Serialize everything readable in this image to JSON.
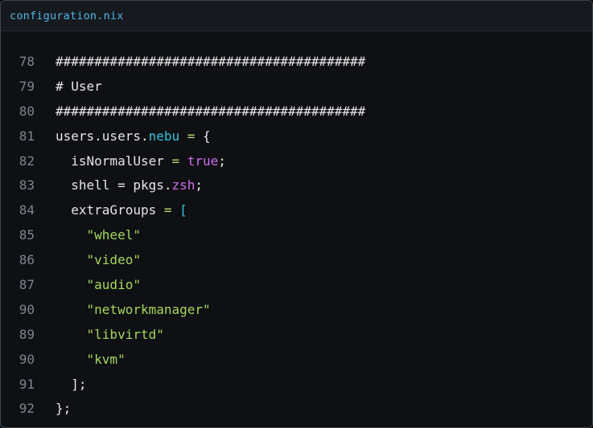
{
  "tab": {
    "filename": "configuration.nix"
  },
  "colors": {
    "background": "#0e1013",
    "tabbar": "#16191e",
    "tab_text": "#4fb7e6",
    "line_number": "#7d8590",
    "string": "#a6d65c",
    "keyword": "#d16cf0",
    "attribute": "#36c2e0"
  },
  "lines": [
    {
      "number": "78",
      "tokens": [
        {
          "text": "########################################",
          "kind": "comment"
        }
      ]
    },
    {
      "number": "79",
      "tokens": [
        {
          "text": "# User",
          "kind": "comment"
        }
      ]
    },
    {
      "number": "80",
      "tokens": [
        {
          "text": "########################################",
          "kind": "comment"
        }
      ]
    },
    {
      "number": "81",
      "tokens": [
        {
          "text": "users.users.",
          "kind": "default"
        },
        {
          "text": "nebu",
          "kind": "attr"
        },
        {
          "text": " = ",
          "kind": "op"
        },
        {
          "text": "{",
          "kind": "default"
        }
      ]
    },
    {
      "number": "82",
      "tokens": [
        {
          "text": "  isNormalUser",
          "kind": "default"
        },
        {
          "text": " = ",
          "kind": "op"
        },
        {
          "text": "true",
          "kind": "bool"
        },
        {
          "text": ";",
          "kind": "default"
        }
      ]
    },
    {
      "number": "83",
      "tokens": [
        {
          "text": "  shell = pkgs.",
          "kind": "default"
        },
        {
          "text": "zsh",
          "kind": "bool"
        },
        {
          "text": ";",
          "kind": "default"
        }
      ]
    },
    {
      "number": "84",
      "tokens": [
        {
          "text": "  extraGroups",
          "kind": "default"
        },
        {
          "text": " = ",
          "kind": "op"
        },
        {
          "text": "[",
          "kind": "bracket"
        }
      ]
    },
    {
      "number": "85",
      "tokens": [
        {
          "text": "    ",
          "kind": "default"
        },
        {
          "text": "\"wheel\"",
          "kind": "string"
        }
      ]
    },
    {
      "number": "86",
      "tokens": [
        {
          "text": "    ",
          "kind": "default"
        },
        {
          "text": "\"video\"",
          "kind": "string"
        }
      ]
    },
    {
      "number": "87",
      "tokens": [
        {
          "text": "    ",
          "kind": "default"
        },
        {
          "text": "\"audio\"",
          "kind": "string"
        }
      ]
    },
    {
      "number": "90",
      "tokens": [
        {
          "text": "    ",
          "kind": "default"
        },
        {
          "text": "\"networkmanager\"",
          "kind": "string"
        }
      ]
    },
    {
      "number": "89",
      "tokens": [
        {
          "text": "    ",
          "kind": "default"
        },
        {
          "text": "\"libvirtd\"",
          "kind": "string"
        }
      ]
    },
    {
      "number": "90",
      "tokens": [
        {
          "text": "    ",
          "kind": "default"
        },
        {
          "text": "\"kvm\"",
          "kind": "string"
        }
      ]
    },
    {
      "number": "91",
      "tokens": [
        {
          "text": "  ];",
          "kind": "default"
        }
      ]
    },
    {
      "number": "92",
      "tokens": [
        {
          "text": "};",
          "kind": "default"
        }
      ]
    }
  ]
}
